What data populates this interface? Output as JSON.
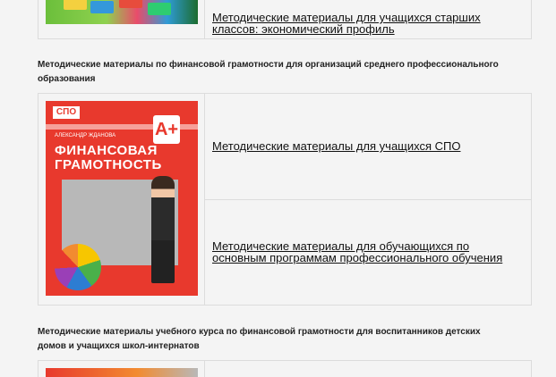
{
  "top_block": {
    "link": "Методические материалы для учащихся старших классов: экономический профиль"
  },
  "spo_section": {
    "title": "Методические материалы по финансовой грамотности для организаций среднего профессионального образования",
    "cover": {
      "badge": "СПО",
      "author": "АЛЕКСАНДР ЖДАНОВА",
      "title_line1": "ФИНАНСОВАЯ",
      "title_line2": "ГРАМОТНОСТЬ",
      "grade": "A+"
    },
    "links": [
      "Методические материалы для учащихся СПО",
      "Методические материалы для обучающихся по основным программам профессионального обучения"
    ]
  },
  "orphan_section": {
    "title": "Методические материалы учебного курса по финансовой грамотности для воспитанников детских домов и учащихся школ-интернатов"
  },
  "colors": {
    "background": "#f4f4f4",
    "border": "#dcdcdc",
    "cover_red": "#e8392d"
  }
}
